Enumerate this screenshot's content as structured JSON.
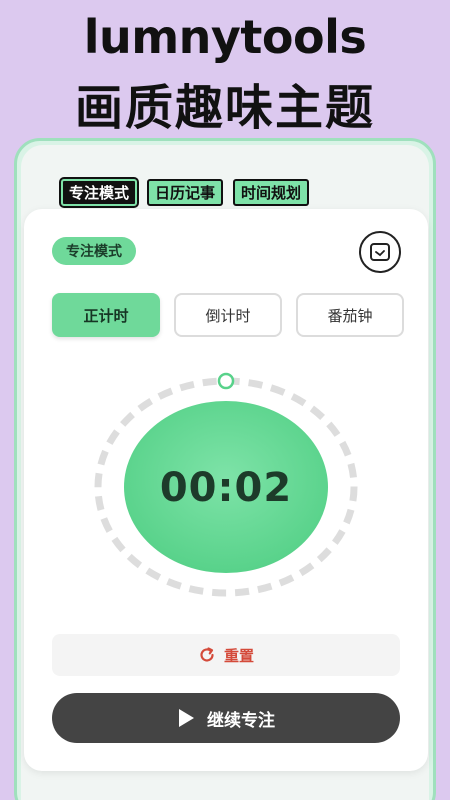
{
  "promo": {
    "line1": "lumnytools",
    "line2": "画质趣味主题"
  },
  "tabs": [
    {
      "label": "专注模式",
      "active": true
    },
    {
      "label": "日历记事",
      "active": false
    },
    {
      "label": "时间规划",
      "active": false
    }
  ],
  "card": {
    "mode_badge": "专注模式",
    "segments": [
      {
        "label": "正计时",
        "active": true
      },
      {
        "label": "倒计时",
        "active": false
      },
      {
        "label": "番茄钟",
        "active": false
      }
    ],
    "timer_display": "00:02",
    "reset_label": "重置",
    "continue_label": "继续专注"
  },
  "colors": {
    "accent_green": "#6fd99a",
    "reset_red": "#d44a3a",
    "button_dark": "#444444",
    "background_purple": "#dcc9ef"
  }
}
